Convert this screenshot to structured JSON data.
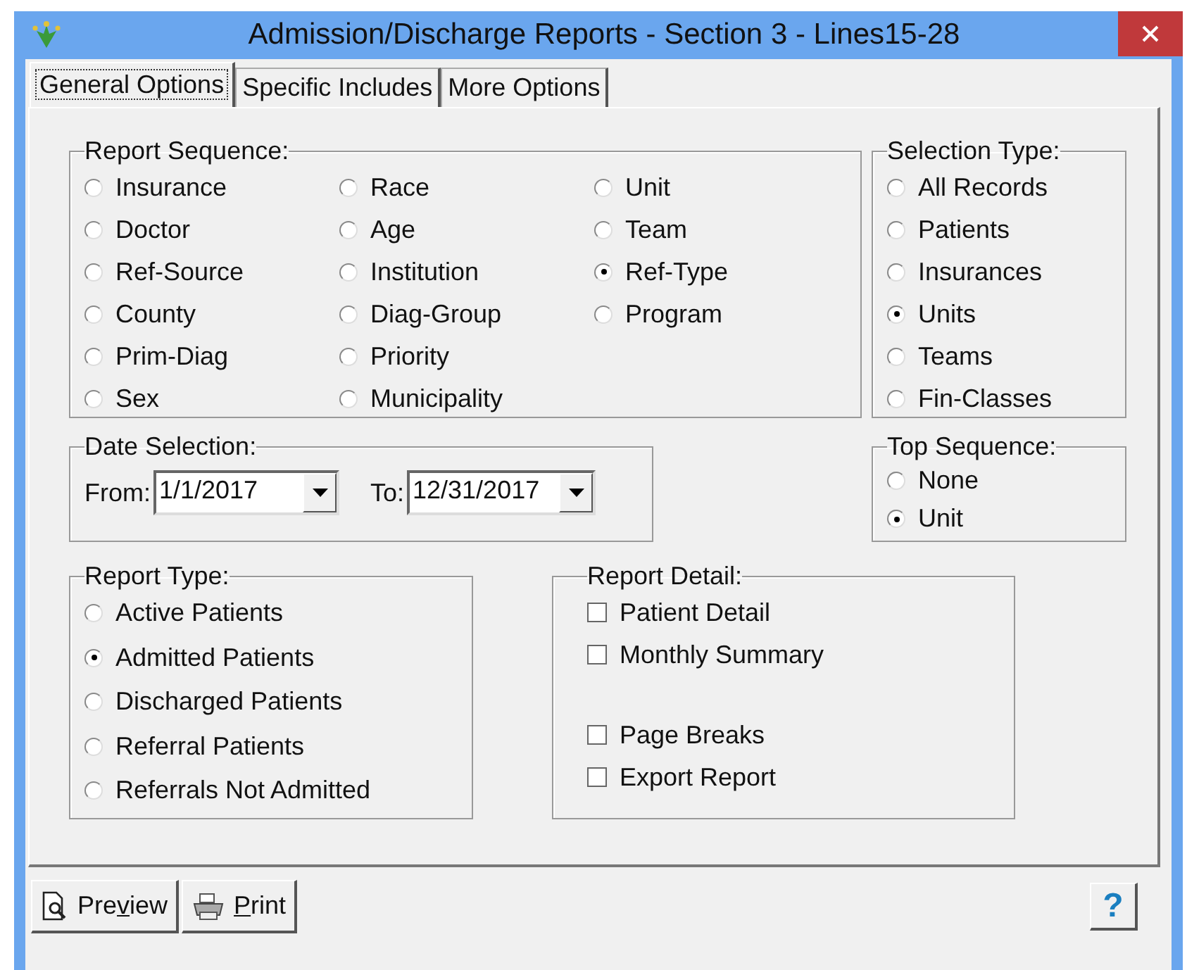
{
  "window": {
    "title": "Admission/Discharge Reports - Section 3 - Lines15-28"
  },
  "tabs": [
    {
      "label": "General Options",
      "selected": true
    },
    {
      "label": "Specific Includes",
      "selected": false
    },
    {
      "label": "More Options",
      "selected": false
    }
  ],
  "report_sequence": {
    "label": "Report Sequence:",
    "columns": [
      [
        {
          "label": "Insurance",
          "selected": false
        },
        {
          "label": "Doctor",
          "selected": false
        },
        {
          "label": "Ref-Source",
          "selected": false
        },
        {
          "label": "County",
          "selected": false
        },
        {
          "label": "Prim-Diag",
          "selected": false
        },
        {
          "label": "Sex",
          "selected": false
        }
      ],
      [
        {
          "label": "Race",
          "selected": false
        },
        {
          "label": "Age",
          "selected": false
        },
        {
          "label": "Institution",
          "selected": false
        },
        {
          "label": "Diag-Group",
          "selected": false
        },
        {
          "label": "Priority",
          "selected": false
        },
        {
          "label": "Municipality",
          "selected": false
        }
      ],
      [
        {
          "label": "Unit",
          "selected": false
        },
        {
          "label": "Team",
          "selected": false
        },
        {
          "label": "Ref-Type",
          "selected": true
        },
        {
          "label": "Program",
          "selected": false
        }
      ]
    ]
  },
  "selection_type": {
    "label": "Selection Type:",
    "options": [
      {
        "label": "All Records",
        "selected": false
      },
      {
        "label": "Patients",
        "selected": false
      },
      {
        "label": "Insurances",
        "selected": false
      },
      {
        "label": "Units",
        "selected": true
      },
      {
        "label": "Teams",
        "selected": false
      },
      {
        "label": "Fin-Classes",
        "selected": false
      }
    ]
  },
  "date_selection": {
    "label": "Date Selection:",
    "from": {
      "label": "From:",
      "value": "1/1/2017"
    },
    "to": {
      "label": "To:",
      "value": "12/31/2017"
    }
  },
  "top_sequence": {
    "label": "Top Sequence:",
    "options": [
      {
        "label": "None",
        "selected": false
      },
      {
        "label": "Unit",
        "selected": true
      }
    ]
  },
  "report_type": {
    "label": "Report Type:",
    "options": [
      {
        "label": "Active Patients",
        "selected": false
      },
      {
        "label": "Admitted Patients",
        "selected": true
      },
      {
        "label": "Discharged Patients",
        "selected": false
      },
      {
        "label": "Referral Patients",
        "selected": false
      },
      {
        "label": "Referrals Not Admitted",
        "selected": false
      }
    ]
  },
  "report_detail": {
    "label": "Report Detail:",
    "groups": [
      [
        {
          "label": "Patient Detail",
          "checked": false
        },
        {
          "label": "Monthly Summary",
          "checked": false
        }
      ],
      [
        {
          "label": "Page Breaks",
          "checked": false
        },
        {
          "label": "Export Report",
          "checked": false
        }
      ]
    ]
  },
  "buttons": [
    {
      "kind": "preview",
      "label_before": "Pre",
      "access_key": "v",
      "label_after": "iew"
    },
    {
      "kind": "print",
      "access_key": "P",
      "label_after": "rint"
    }
  ],
  "help_button": {
    "label": "?"
  }
}
